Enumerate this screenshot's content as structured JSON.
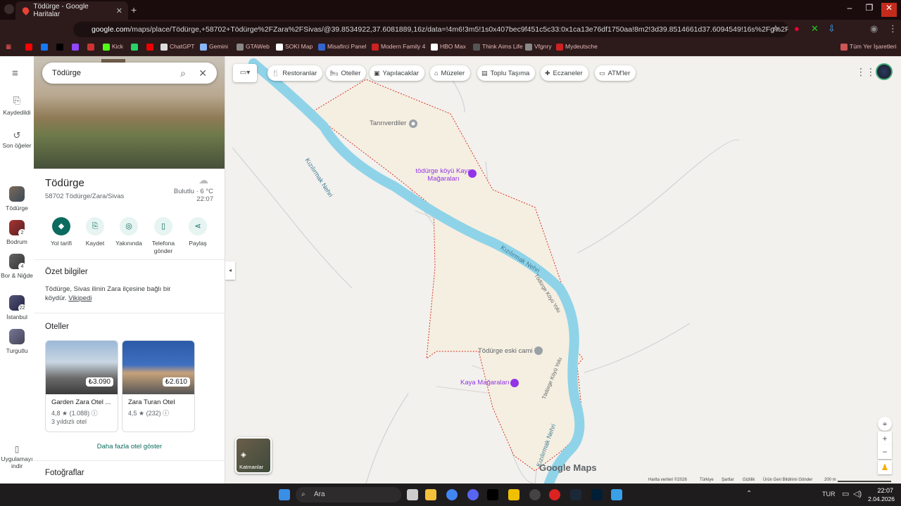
{
  "browser": {
    "tab_title": "Tödürge - Google Haritalar",
    "url_domain": "google.com",
    "url_path": "/maps/place/Tödürge,+58702+Tödürge%2FZara%2FSivas/@39.8534922,37.6081889,16z/data=!4m6!3m5!1s0x407bec9f451c5c33:0x1ca13e76df1750aa!8m2!3d39.8514661d37.6094549!16s%2Fg%2F11b5q7b95k?ent...",
    "bookmarks": [
      "Kick",
      "ChatGPT",
      "Gemini",
      "GTAWeb",
      "SOKI Map",
      "Misafirci Panel",
      "Modern Family 4",
      "HBO Max",
      "Think Aims Life",
      "Vfgnry",
      "Mydeutsche"
    ],
    "all_bookmarks": "Tüm Yer İşaretleri"
  },
  "search": {
    "query": "Tödürge"
  },
  "rail": [
    {
      "label": "Kaydedildi",
      "icon": "bookmark-icon"
    },
    {
      "label": "Son öğeler",
      "icon": "history-icon"
    },
    {
      "label": "Tödürge",
      "icon": "thumb"
    },
    {
      "label": "Bodrum",
      "badge": "2"
    },
    {
      "label": "Bor & Niğde",
      "badge": "4"
    },
    {
      "label": "İstanbul",
      "badge": "22"
    },
    {
      "label": "Turgutlu"
    },
    {
      "label": "Uygulamayı indir",
      "icon": "phone-icon"
    }
  ],
  "place": {
    "title": "Tödürge",
    "address": "58702 Tödürge/Zara/Sivas",
    "weather": "Bulutlu · 6 °C",
    "time": "22:07"
  },
  "actions": [
    "Yol tarifi",
    "Kaydet",
    "Yakınında",
    "Telefona gönder",
    "Paylaş"
  ],
  "summary": {
    "heading": "Özet bilgiler",
    "text": "Tödürge, Sivas ilinin Zara ilçesine bağlı bir köydür.",
    "link": "Vikipedi"
  },
  "hotels": {
    "heading": "Oteller",
    "items": [
      {
        "name": "Garden Zara Otel ...",
        "price": "₺3.090",
        "rating": "4,8 ★ (1.088)",
        "class": "3 yıldızlı otel"
      },
      {
        "name": "Zara Turan Otel",
        "price": "₺2.610",
        "rating": "4,5 ★ (232)",
        "class": ""
      }
    ],
    "more": "Daha fazla otel göster"
  },
  "photos_heading": "Fotoğraflar",
  "chips": [
    "Restoranlar",
    "Oteller",
    "Yapılacaklar",
    "Müzeler",
    "Toplu Taşıma",
    "Eczaneler",
    "ATM'ler"
  ],
  "map_labels": {
    "village1": "Tanrıverdiler",
    "poi1": "tödürge köyü Kaya Mağaraları",
    "river1": "Kızılırmak Nehri",
    "river2": "Kızılırmak Nehri",
    "river3": "Kızılırmak Nehri",
    "road1": "Tödürge Köyü Yolu",
    "road2": "Tödürge Köyü Yolu",
    "mosque": "Tödürge eski cami",
    "poi2": "Kaya Mağaraları",
    "layers": "Katmanlar",
    "brand": "Google Maps"
  },
  "footer": {
    "data": "Harita verileri ©2026",
    "country": "Türkiye",
    "terms": "Şartlar",
    "privacy": "Gizlilik",
    "feedback": "Ürün Geri Bildirimi Gönder",
    "scale": "200 m"
  },
  "taskbar": {
    "search": "Ara",
    "lang": "TUR",
    "time": "22:07",
    "date": "2.04.2026"
  },
  "colors": {
    "accent": "#0b6b5f",
    "river": "#8fd3e9",
    "boundary": "#d93025"
  }
}
